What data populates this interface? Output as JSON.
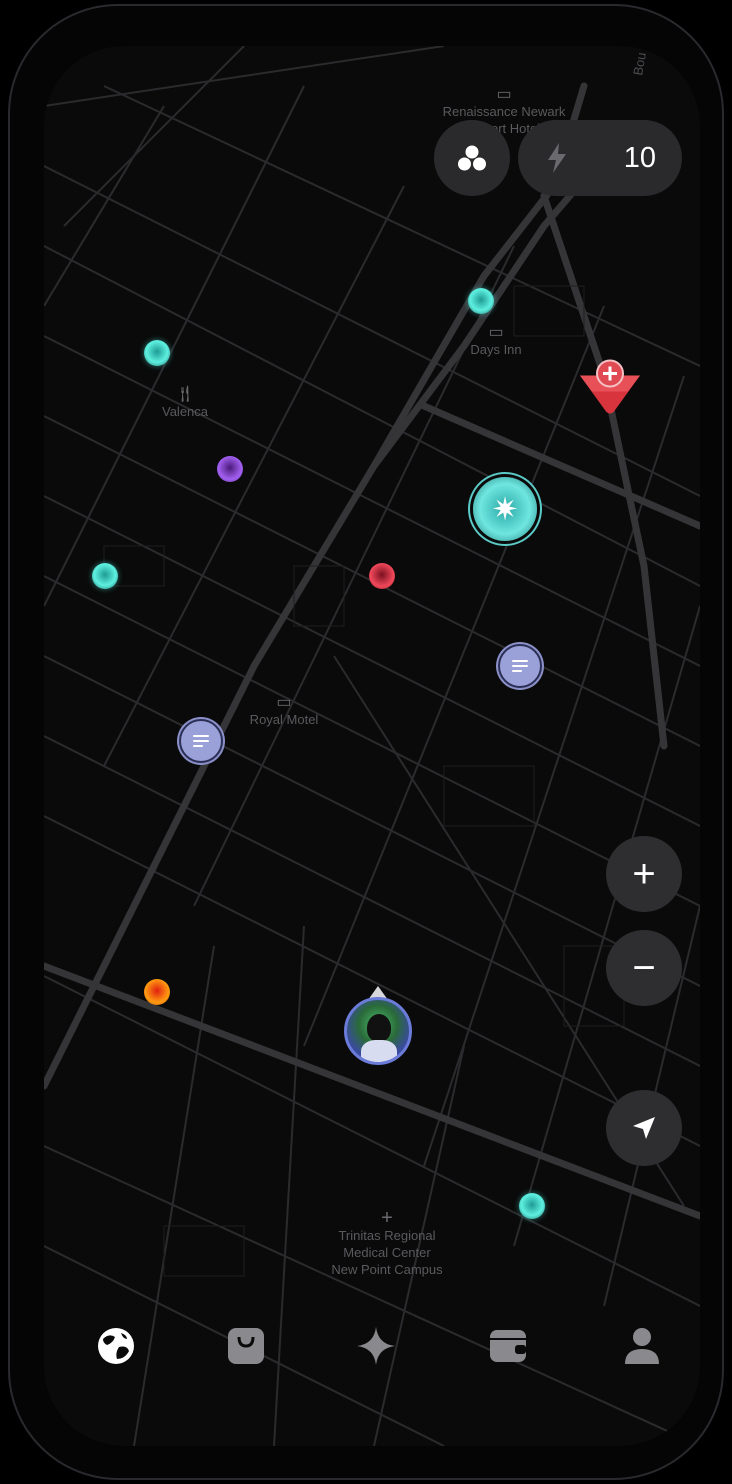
{
  "map": {
    "places": [
      {
        "name": "Renaissance Newark Airport Hotel",
        "line1": "Renaissance Newark",
        "line2": "Airport Hotel",
        "icon": "bed-icon"
      },
      {
        "name": "Days Inn",
        "line1": "Days Inn",
        "icon": "bed-icon"
      },
      {
        "name": "Valenca",
        "line1": "Valenca",
        "icon": "fork-knife-icon"
      },
      {
        "name": "Royal Motel",
        "line1": "Royal Motel",
        "icon": "bed-icon"
      },
      {
        "name": "Trinitas Regional Medical Center New Point Campus",
        "line1": "Trinitas Regional",
        "line2": "Medical Center",
        "line3": "New Point Campus",
        "icon": "hospital-cross-icon"
      }
    ],
    "street_label": "Bou"
  },
  "header": {
    "groups_icon": "groups-icon",
    "energy_icon": "lightning-icon",
    "energy_count": "10"
  },
  "controls": {
    "zoom_in": "+",
    "zoom_out": "−",
    "locate_icon": "navigation-arrow-icon"
  },
  "colors": {
    "teal": "#5ef0e0",
    "purple": "#a25ff0",
    "red": "#f0485a",
    "orange": "#ff9a10",
    "note": "#9aa0d8",
    "pin_red": "#d8343e",
    "button_bg": "#2a2a2c"
  },
  "tabs": [
    {
      "name": "globe",
      "icon": "globe-icon",
      "active": true
    },
    {
      "name": "shop",
      "icon": "bag-icon",
      "active": false
    },
    {
      "name": "sparkle",
      "icon": "sparkle-icon",
      "active": false
    },
    {
      "name": "wallet",
      "icon": "wallet-icon",
      "active": false
    },
    {
      "name": "profile",
      "icon": "person-icon",
      "active": false
    }
  ]
}
